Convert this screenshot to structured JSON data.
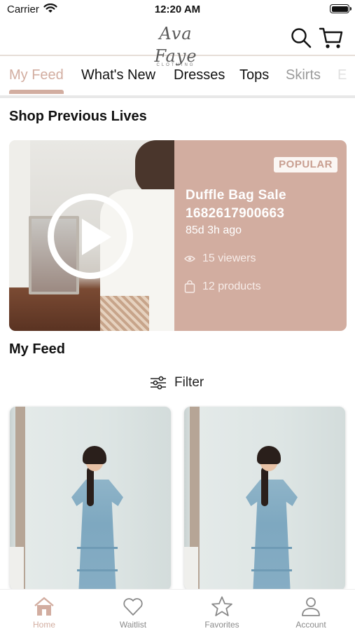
{
  "status_bar": {
    "carrier": "Carrier",
    "time": "12:20 AM"
  },
  "header": {
    "logo_text": "Ava Faye",
    "logo_subtext": "CLOTHING",
    "search_icon": "search-icon",
    "cart_icon": "cart-icon"
  },
  "tabs": {
    "items": [
      {
        "label": "My Feed",
        "active": true
      },
      {
        "label": "What's New"
      },
      {
        "label": "Dresses"
      },
      {
        "label": "Tops"
      },
      {
        "label": "Skirts"
      },
      {
        "label": "E"
      }
    ]
  },
  "previous_lives": {
    "title": "Shop Previous Lives",
    "card": {
      "badge": "POPULAR",
      "title": "Duffle Bag Sale 1682617900663",
      "ago": "85d 3h ago",
      "viewers": "15 viewers",
      "products": "12 products"
    }
  },
  "feed": {
    "title": "My Feed",
    "filter_label": "Filter"
  },
  "bottom_nav": {
    "items": [
      {
        "label": "Home",
        "icon": "home-icon",
        "active": true
      },
      {
        "label": "Waitlist",
        "icon": "heart-icon"
      },
      {
        "label": "Favorites",
        "icon": "star-icon"
      },
      {
        "label": "Account",
        "icon": "account-icon"
      }
    ]
  },
  "colors": {
    "accent": "#d2ada0",
    "text": "#111111",
    "muted": "#8a8a8a"
  }
}
